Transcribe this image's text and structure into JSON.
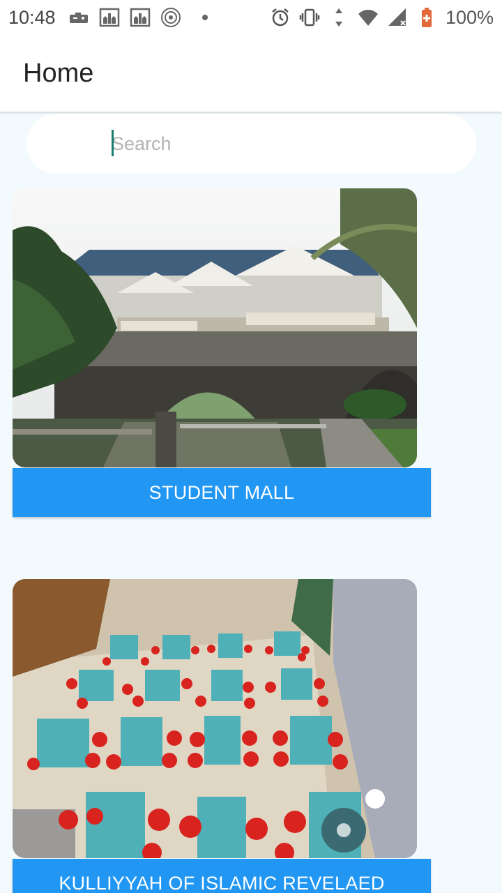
{
  "status_bar": {
    "time": "10:48",
    "battery": "100%",
    "left_icons": [
      "game-controller-icon",
      "mosque-image-icon",
      "mosque-image-icon",
      "seal-icon"
    ],
    "right_icons": [
      "alarm-icon",
      "vibrate-icon",
      "data-arrows-icon",
      "wifi-icon",
      "signal-icon",
      "battery-icon"
    ]
  },
  "app_bar": {
    "title": "Home"
  },
  "search": {
    "placeholder": "Search",
    "value": ""
  },
  "places": [
    {
      "name": "STUDENT MALL",
      "image": "student-mall-photo"
    },
    {
      "name": "KULLIYYAH OF ISLAMIC REVELAED",
      "image": "cafeteria-photo"
    }
  ],
  "colors": {
    "accent": "#2196f3",
    "background": "#f3fafd",
    "caret": "#1a7c6f"
  }
}
